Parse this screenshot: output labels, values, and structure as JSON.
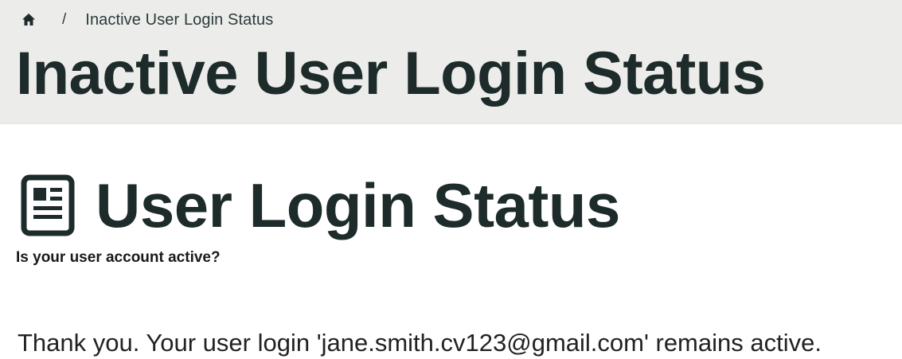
{
  "breadcrumb": {
    "home_icon": "home-icon",
    "separator": "/",
    "current": "Inactive User Login Status"
  },
  "header": {
    "title": "Inactive User Login Status",
    "background_color": "#ececea"
  },
  "section": {
    "icon": "document-list-icon",
    "title": "User Login Status",
    "subtitle": "Is your user account active?"
  },
  "message": {
    "text": "Thank you. Your user login 'jane.smith.cv123@gmail.com' remains active."
  }
}
